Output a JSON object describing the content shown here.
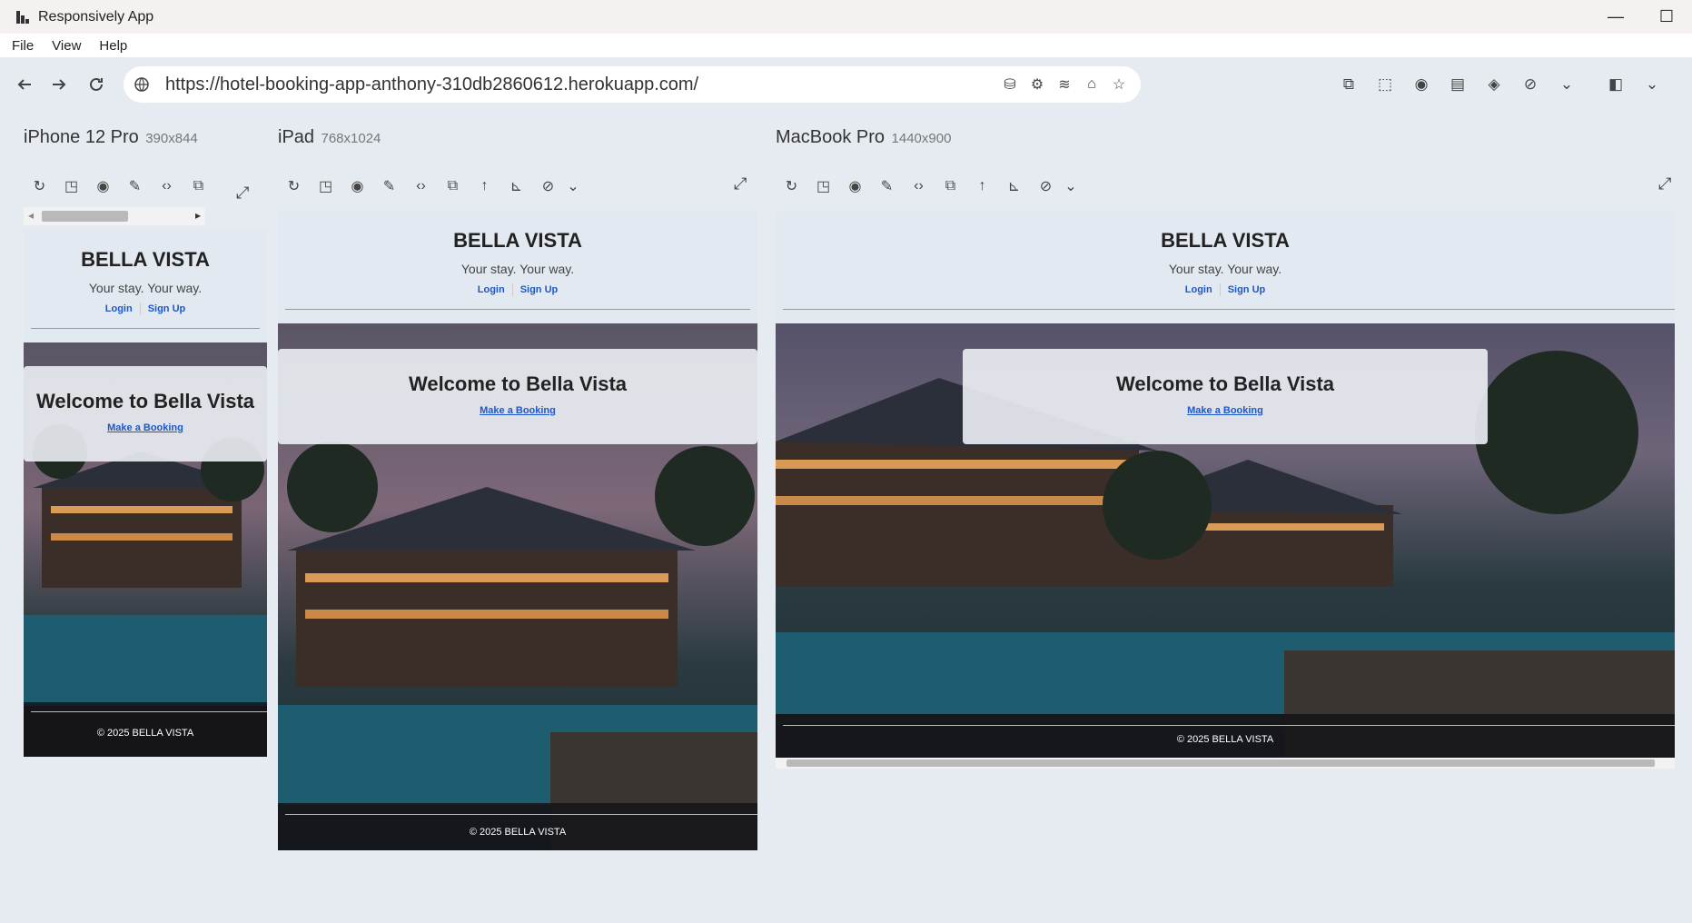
{
  "window": {
    "title": "Responsively App",
    "minimize": "—",
    "maximize": "☐"
  },
  "menu": {
    "file": "File",
    "view": "View",
    "help": "Help"
  },
  "nav": {
    "url": "https://hotel-booking-app-anthony-310db2860612.herokuapp.com/",
    "icons": [
      "back-icon",
      "forward-icon",
      "reload-icon",
      "globe-icon"
    ]
  },
  "devices": {
    "iphone": {
      "name": "iPhone 12 Pro",
      "res": "390x844"
    },
    "ipad": {
      "name": "iPad",
      "res": "768x1024"
    },
    "macbook": {
      "name": "MacBook Pro",
      "res": "1440x900"
    }
  },
  "site": {
    "brand": "BELLA VISTA",
    "tagline": "Your stay. Your way.",
    "login": "Login",
    "signup": "Sign Up",
    "welcome": "Welcome to Bella Vista",
    "booking": "Make a Booking",
    "footer": "© 2025 BELLA VISTA"
  },
  "colors": {
    "accent": "#1e58c8",
    "workspace": "#e6ebf2",
    "titlebar": "#f5f1f1"
  }
}
